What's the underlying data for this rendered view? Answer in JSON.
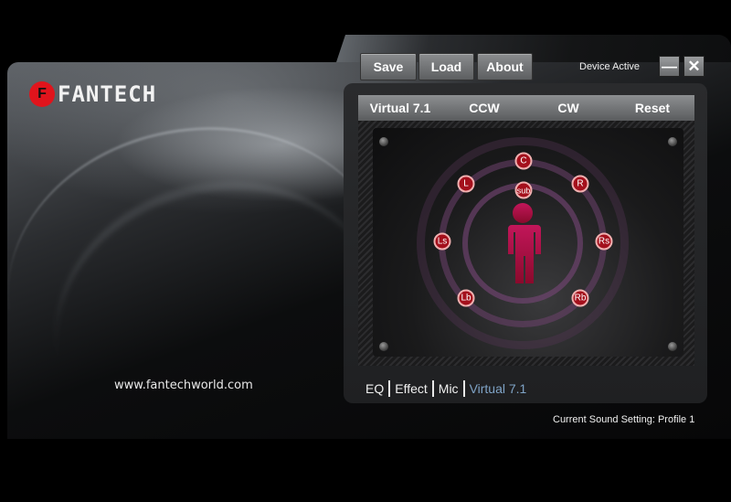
{
  "brand": {
    "name": "FANTECH",
    "logo_icon": "fantech-logo-icon",
    "website": "www.fantechworld.com"
  },
  "toolbar": {
    "save_label": "Save",
    "load_label": "Load",
    "about_label": "About"
  },
  "status": {
    "device": "Device Active",
    "current_setting": "Current Sound Setting: Profile 1"
  },
  "window_controls": {
    "minimize_glyph": "—",
    "close_glyph": "✕"
  },
  "tabs": [
    {
      "label": "Virtual 7.1"
    },
    {
      "label": "CCW"
    },
    {
      "label": "CW"
    },
    {
      "label": "Reset"
    }
  ],
  "speakers": [
    {
      "label": "C",
      "id": "center"
    },
    {
      "label": "L",
      "id": "left"
    },
    {
      "label": "R",
      "id": "right"
    },
    {
      "label": "sub",
      "id": "subwoofer"
    },
    {
      "label": "Ls",
      "id": "left-surround"
    },
    {
      "label": "Rs",
      "id": "right-surround"
    },
    {
      "label": "Lb",
      "id": "left-back"
    },
    {
      "label": "Rb",
      "id": "right-back"
    }
  ],
  "bottom_nav": [
    {
      "label": "EQ",
      "active": false
    },
    {
      "label": "Effect",
      "active": false
    },
    {
      "label": "Mic",
      "active": false
    },
    {
      "label": "Virtual 7.1",
      "active": true
    }
  ],
  "colors": {
    "accent_red": "#a4101c",
    "active_nav": "#7fa3c6",
    "figure": "#c0104a"
  }
}
